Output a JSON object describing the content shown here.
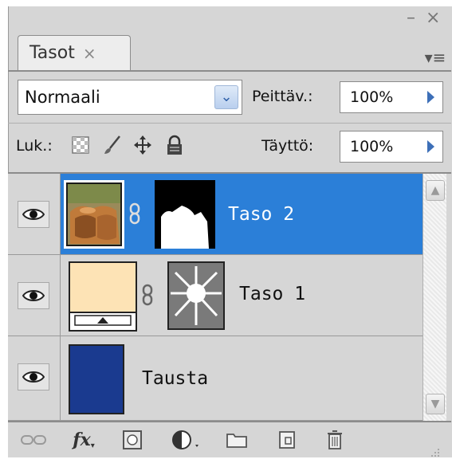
{
  "panel": {
    "tab_label": "Tasot",
    "tab_close": "×",
    "minimize": "–",
    "close": "×",
    "menu_glyph": "▾≡"
  },
  "blend": {
    "mode": "Normaali",
    "opacity_label": "Peittäv.:",
    "opacity_value": "100%"
  },
  "lock": {
    "label": "Luk.:",
    "fill_label": "Täyttö:",
    "fill_value": "100%",
    "icons": [
      "lock-transparent-icon",
      "lock-paint-icon",
      "lock-move-icon",
      "lock-all-icon"
    ]
  },
  "layers": [
    {
      "name": "Taso 2",
      "selected": true,
      "visible": true,
      "has_mask": true,
      "linked": true
    },
    {
      "name": "Taso 1",
      "selected": false,
      "visible": true,
      "has_mask": true,
      "linked": true
    },
    {
      "name": "Tausta",
      "selected": false,
      "visible": true,
      "has_mask": false,
      "linked": false
    }
  ],
  "footer_tools": [
    "link-layers-icon",
    "fx-icon",
    "add-mask-icon",
    "adjustment-layer-icon",
    "new-group-icon",
    "new-layer-icon",
    "trash-icon"
  ],
  "footer_fx_text": "fx",
  "colors": {
    "selected_row": "#2b7fd8",
    "panel_bg": "#d6d6d6",
    "background_layer": "#1a3a8f",
    "fill_layer": "#fde3b5"
  }
}
